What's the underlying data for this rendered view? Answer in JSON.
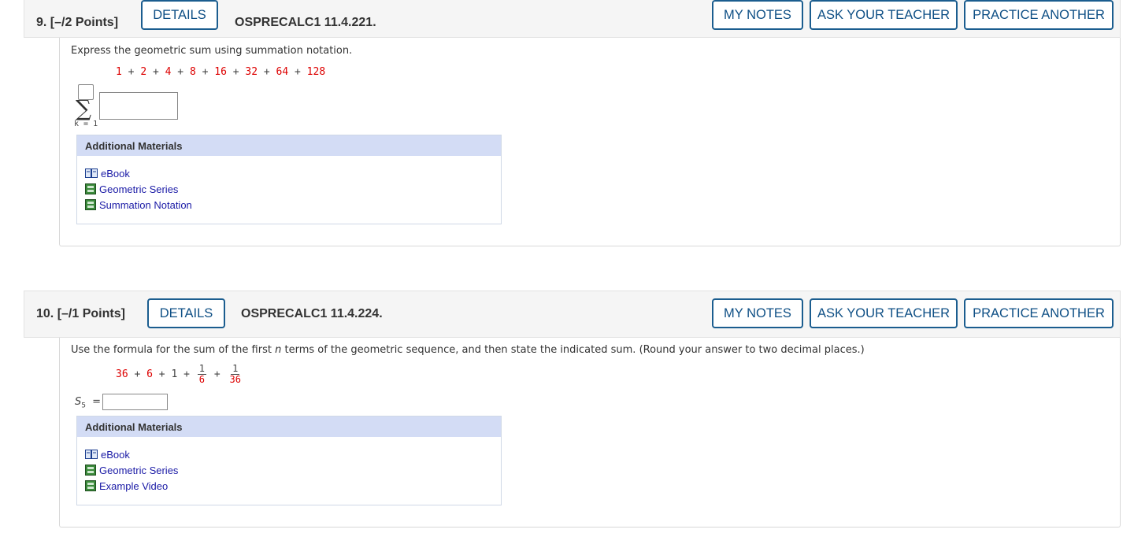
{
  "q9": {
    "number": "9.",
    "points": "[–/2 Points]",
    "details": "DETAILS",
    "code": "OSPRECALC1 11.4.221.",
    "my_notes": "MY NOTES",
    "ask_teacher": "ASK YOUR TEACHER",
    "practice_another": "PRACTICE ANOTHER",
    "prompt": "Express the geometric sum using summation notation.",
    "series": [
      "1",
      "2",
      "4",
      "8",
      "16",
      "32",
      "64",
      "128"
    ],
    "plus": "+",
    "sigma": "∑",
    "k_label": "k = 1",
    "materials": {
      "title": "Additional Materials",
      "items": [
        "eBook",
        "Geometric Series",
        "Summation Notation"
      ]
    }
  },
  "q10": {
    "number": "10.",
    "points": "[–/1 Points]",
    "details": "DETAILS",
    "code": "OSPRECALC1 11.4.224.",
    "my_notes": "MY NOTES",
    "ask_teacher": "ASK YOUR TEACHER",
    "practice_another": "PRACTICE ANOTHER",
    "prompt_before": "Use the formula for the sum of the first ",
    "prompt_var": "n",
    "prompt_after": " terms of the geometric sequence, and then state the indicated sum. (Round your answer to two decimal places.)",
    "series": {
      "t1": "36",
      "t2": "6",
      "t3": "1",
      "f1_num": "1",
      "f1_den": "6",
      "f2_num": "1",
      "f2_den": "36"
    },
    "plus": "+",
    "s_label": "S",
    "s_sub": "5",
    "equals": "=",
    "materials": {
      "title": "Additional Materials",
      "items": [
        "eBook",
        "Geometric Series",
        "Example Video"
      ]
    }
  },
  "colors": {
    "button_border": "#1b5d8f",
    "materials_header": "#d3dcf5",
    "math_red": "#dd0000",
    "link": "#1a1aa6"
  }
}
